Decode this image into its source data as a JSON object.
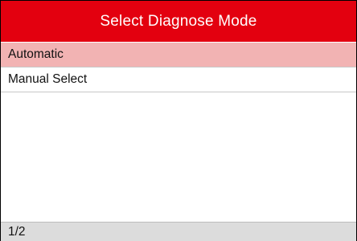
{
  "header": {
    "title": "Select Diagnose Mode"
  },
  "menu": {
    "items": [
      {
        "label": "Automatic",
        "selected": true
      },
      {
        "label": "Manual Select",
        "selected": false
      }
    ]
  },
  "footer": {
    "page_indicator": "1/2"
  },
  "colors": {
    "title_bar": "#e3000f",
    "selected_row": "#f2b3b3",
    "status_bar": "#dcdcdc"
  }
}
